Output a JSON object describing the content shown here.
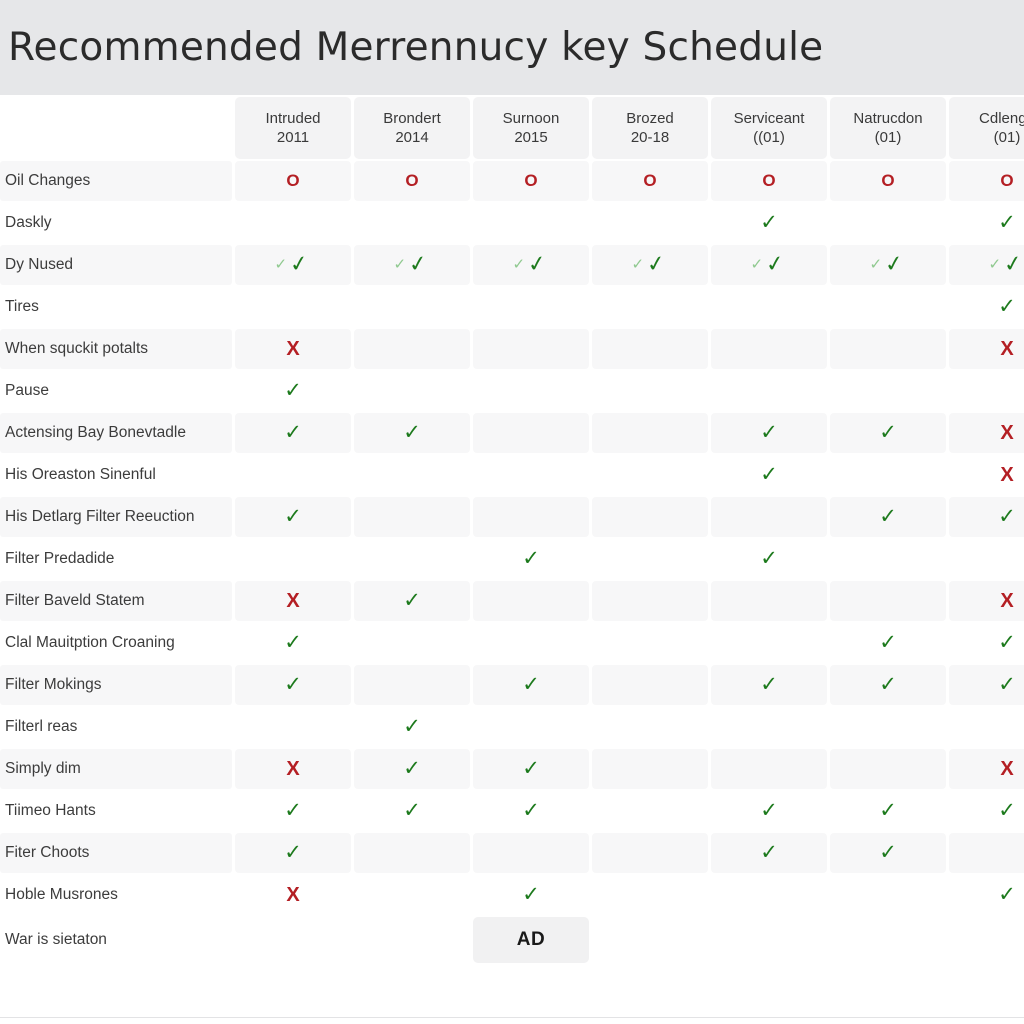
{
  "header": {
    "title": "Recommended Merrennucy key Schedule"
  },
  "columns": [
    {
      "name": "Intruded",
      "sub": "2011"
    },
    {
      "name": "Brondert",
      "sub": "2014"
    },
    {
      "name": "Surnoon",
      "sub": "2015"
    },
    {
      "name": "Brozed",
      "sub": "20-18"
    },
    {
      "name": "Serviceant",
      "sub": "((01)"
    },
    {
      "name": "Natrucdon",
      "sub": "(01)"
    },
    {
      "name": "Cdlenge",
      "sub": "(01)"
    }
  ],
  "marks": {
    "check": "✓",
    "cross": "✘",
    "circle": "⭘",
    "ad": "AD"
  },
  "colors": {
    "check_green": "#1d7a1d",
    "cross_red": "#b41f24",
    "circle_red": "#b41f24",
    "title_band": "#e6e7e9",
    "stripe": "#f7f7f8",
    "header_cell": "#f3f3f4"
  },
  "rows": [
    {
      "label": "Oil Changes",
      "striped": true,
      "cells": [
        "circle",
        "circle",
        "circle",
        "circle",
        "circle",
        "circle",
        "circle"
      ]
    },
    {
      "label": "Daskly",
      "striped": false,
      "cells": [
        "",
        "",
        "",
        "",
        "check",
        "",
        "check"
      ]
    },
    {
      "label": "Dy Nused",
      "striped": true,
      "cells": [
        "dblcheck",
        "dblcheck",
        "dblcheck",
        "dblcheck",
        "dblcheck",
        "dblcheck",
        "dblcheck"
      ]
    },
    {
      "label": "Tires",
      "striped": false,
      "cells": [
        "",
        "",
        "",
        "",
        "",
        "",
        "check"
      ]
    },
    {
      "label": "When squckit potalts",
      "striped": true,
      "cells": [
        "cross",
        "",
        "",
        "",
        "",
        "",
        "cross"
      ]
    },
    {
      "label": "Pause",
      "striped": false,
      "cells": [
        "check",
        "",
        "",
        "",
        "",
        "",
        ""
      ]
    },
    {
      "label": "Actensing Bay Bonevtadle",
      "striped": true,
      "cells": [
        "check",
        "check",
        "",
        "",
        "check",
        "check",
        "cross"
      ]
    },
    {
      "label": "His Oreaston Sinenful",
      "striped": false,
      "cells": [
        "",
        "",
        "",
        "",
        "check",
        "",
        "cross"
      ]
    },
    {
      "label": "His Detlarg Filter Reeuction",
      "striped": true,
      "cells": [
        "check",
        "",
        "",
        "",
        "",
        "check",
        "check"
      ]
    },
    {
      "label": "Filter Predadide",
      "striped": false,
      "cells": [
        "",
        "",
        "check",
        "",
        "check",
        "",
        ""
      ]
    },
    {
      "label": "Filter Baveld Statem",
      "striped": true,
      "cells": [
        "cross",
        "check",
        "",
        "",
        "",
        "",
        "cross"
      ]
    },
    {
      "label": "Clal Mauitption Croaning",
      "striped": false,
      "cells": [
        "check",
        "",
        "",
        "",
        "",
        "check",
        "check"
      ]
    },
    {
      "label": "Filter Mokings",
      "striped": true,
      "cells": [
        "check",
        "",
        "check",
        "",
        "check",
        "check",
        "check"
      ]
    },
    {
      "label": "Filterl reas",
      "striped": false,
      "cells": [
        "",
        "check",
        "",
        "",
        "",
        "",
        ""
      ]
    },
    {
      "label": "Simply dim",
      "striped": true,
      "cells": [
        "cross",
        "check",
        "check",
        "",
        "",
        "",
        "cross"
      ]
    },
    {
      "label": "Tiimeo Hants",
      "striped": false,
      "cells": [
        "check",
        "check",
        "check",
        "",
        "check",
        "check",
        "check"
      ]
    },
    {
      "label": "Fiter Choots",
      "striped": true,
      "cells": [
        "check",
        "",
        "",
        "",
        "check",
        "check",
        ""
      ]
    },
    {
      "label": "Hoble Musrones",
      "striped": false,
      "cells": [
        "cross",
        "",
        "check",
        "",
        "",
        "",
        "check"
      ]
    },
    {
      "label": "War is sietaton",
      "striped": false,
      "cells": [
        "",
        "",
        "ad",
        "",
        "",
        "",
        ""
      ]
    }
  ]
}
